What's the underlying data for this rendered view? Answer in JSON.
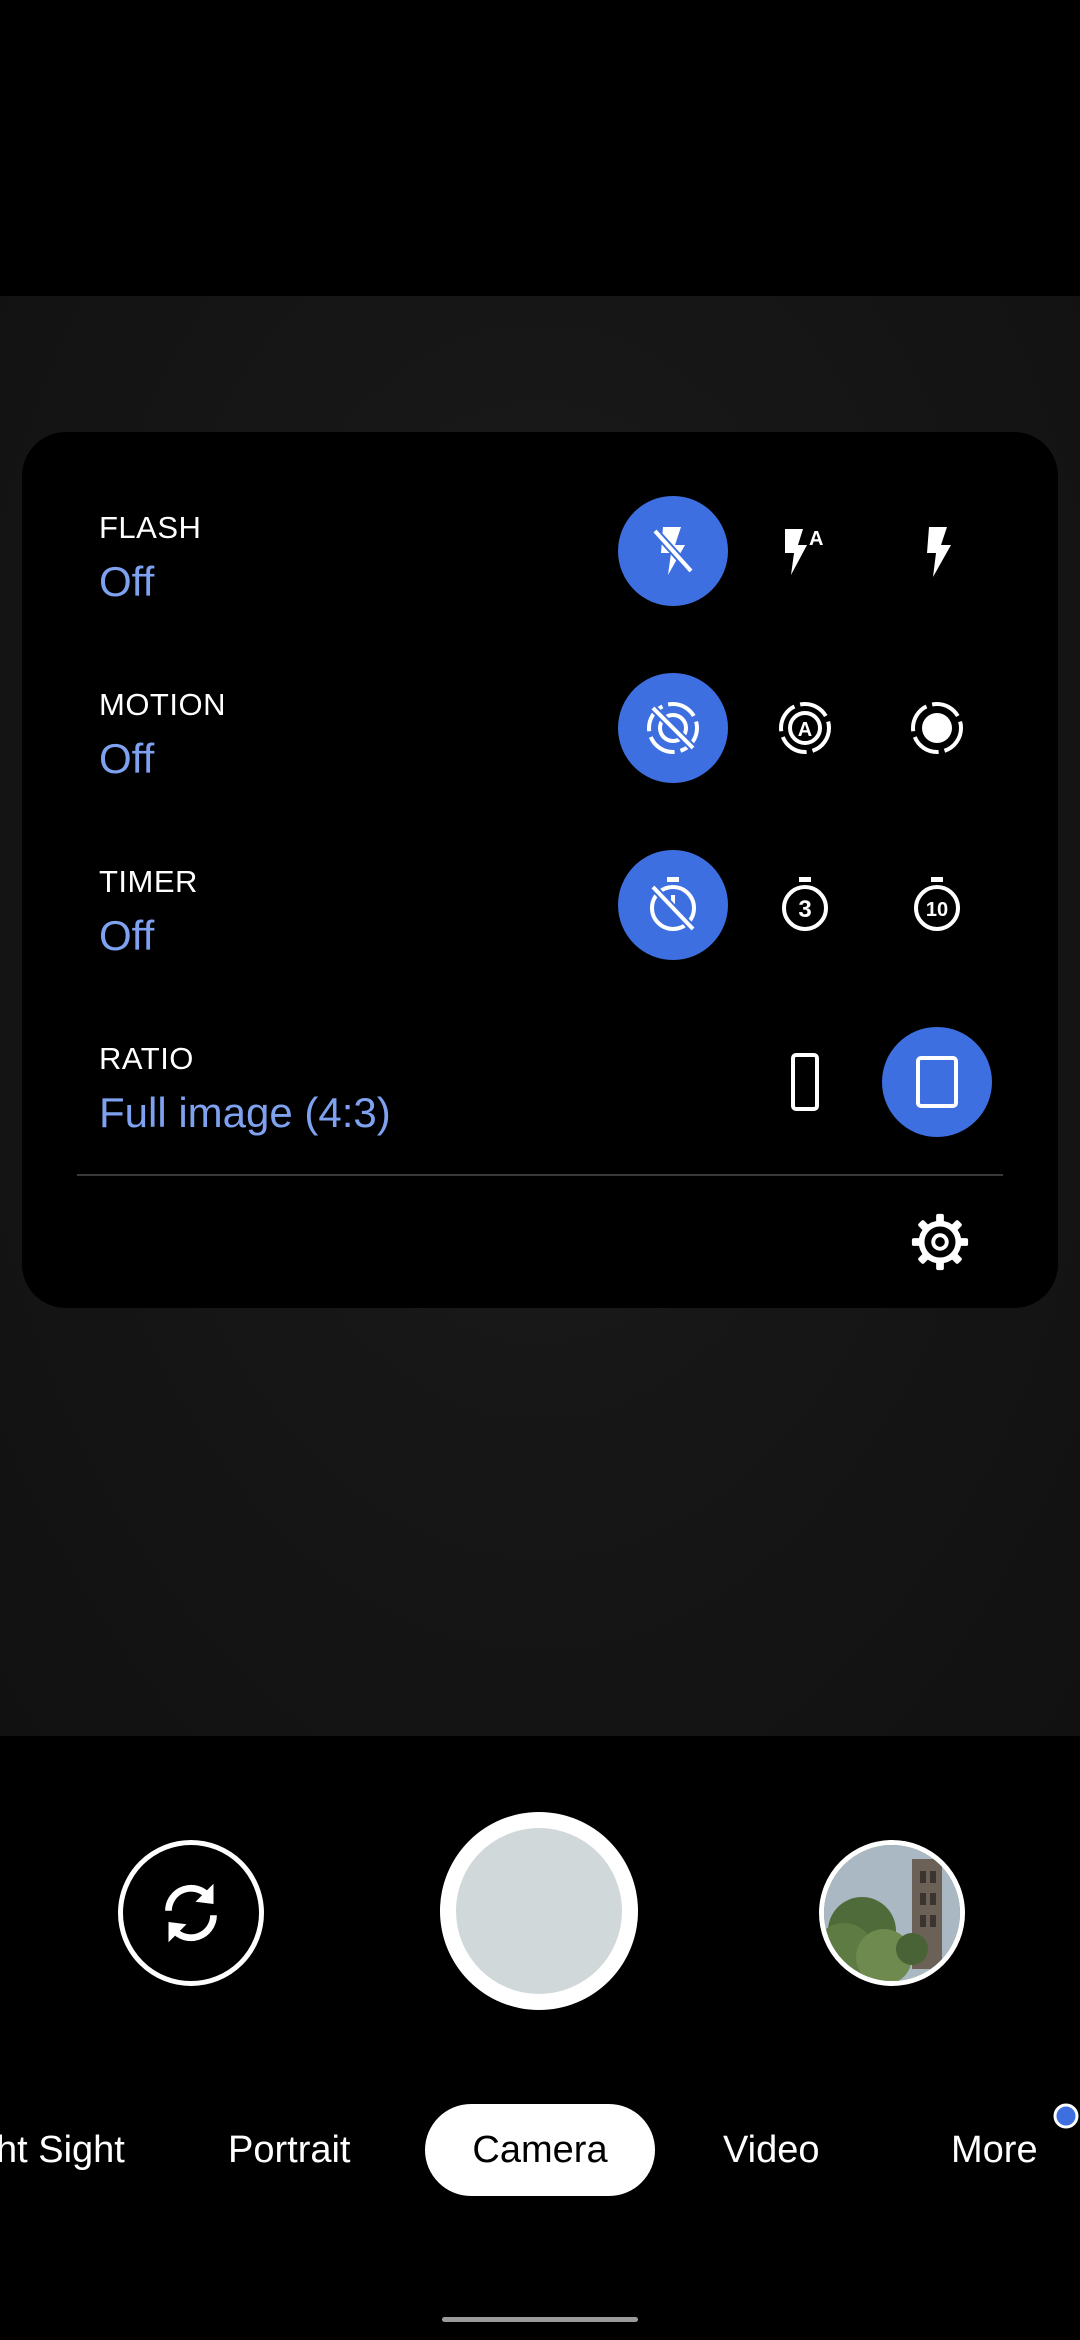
{
  "settings_panel": {
    "rows": [
      {
        "label": "FLASH",
        "value": "Off",
        "options": [
          "flash-off-icon",
          "flash-auto-icon",
          "flash-on-icon"
        ],
        "selected": 0
      },
      {
        "label": "MOTION",
        "value": "Off",
        "options": [
          "motion-off-icon",
          "motion-auto-icon",
          "motion-on-icon"
        ],
        "selected": 0
      },
      {
        "label": "TIMER",
        "value": "Off",
        "options": [
          "timer-off-icon",
          "timer-3s-icon",
          "timer-10s-icon"
        ],
        "selected": 0
      },
      {
        "label": "RATIO",
        "value": "Full image (4:3)",
        "options": [
          "ratio-wide-icon",
          "ratio-full-icon"
        ],
        "selected": 1
      }
    ],
    "settings_icon": "gear-icon"
  },
  "controls": {
    "flip_icon": "camera-flip-icon",
    "shutter_label": "shutter",
    "gallery_icon": "gallery-thumbnail"
  },
  "modes": {
    "items": [
      "ht Sight",
      "Portrait",
      "Camera",
      "Video",
      "More"
    ],
    "active": "Camera"
  },
  "colors": {
    "accent": "#3e6fe0",
    "value_text": "#7ea2ef",
    "panel": "#000000",
    "viewfinder": "#161616",
    "shutter_inner": "#d1d8da",
    "notification_dot": "#3e6fe0"
  }
}
